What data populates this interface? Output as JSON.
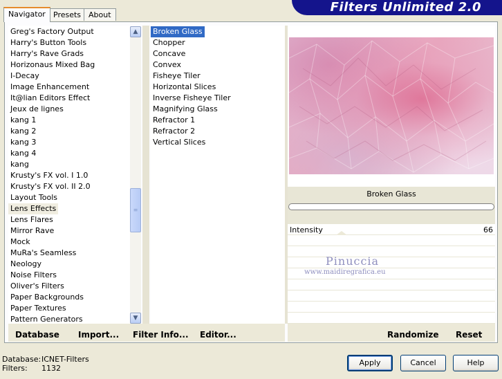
{
  "app": {
    "title": "Filters Unlimited 2.0"
  },
  "tabs": [
    {
      "label": "Navigator",
      "active": true
    },
    {
      "label": "Presets",
      "active": false
    },
    {
      "label": "About",
      "active": false
    }
  ],
  "categories": {
    "items": [
      "Greg's Factory Output",
      "Harry's Button Tools",
      "Harry's Rave Grads",
      "Horizonaus Mixed Bag",
      "I-Decay",
      "Image Enhancement",
      "It@lian Editors Effect",
      "Jeux de lignes",
      "kang 1",
      "kang 2",
      "kang 3",
      "kang 4",
      "kang",
      "Krusty's FX vol. I 1.0",
      "Krusty's FX vol. II 2.0",
      "Layout Tools",
      "Lens Effects",
      "Lens Flares",
      "Mirror Rave",
      "Mock",
      "MuRa's Seamless",
      "Neology",
      "Noise Filters",
      "Oliver's Filters",
      "Paper Backgrounds",
      "Paper Textures",
      "Pattern Generators"
    ],
    "selected": "Lens Effects"
  },
  "filters": {
    "items": [
      "Broken Glass",
      "Chopper",
      "Concave",
      "Convex",
      "Fisheye Tiler",
      "Horizontal Slices",
      "Inverse Fisheye Tiler",
      "Magnifying Glass",
      "Refractor 1",
      "Refractor 2",
      "Vertical Slices"
    ],
    "selected": "Broken Glass"
  },
  "toolbar": {
    "database": "Database",
    "import": "Import...",
    "filter_info": "Filter Info...",
    "editor": "Editor...",
    "randomize": "Randomize",
    "reset": "Reset"
  },
  "preview": {
    "filter_name": "Broken Glass",
    "progress": 0
  },
  "params": [
    {
      "label": "Intensity",
      "value": "66"
    }
  ],
  "watermark": {
    "name": "Pinuccia",
    "url": "www.maidiregrafica.eu"
  },
  "footer": {
    "database_label": "Database:",
    "database_value": "ICNET-Filters",
    "filters_label": "Filters:",
    "filters_value": "1132",
    "apply": "Apply",
    "cancel": "Cancel",
    "help": "Help"
  },
  "colors": {
    "banner": "#14148c",
    "selection": "#316ac5",
    "face": "#ece9d8"
  }
}
